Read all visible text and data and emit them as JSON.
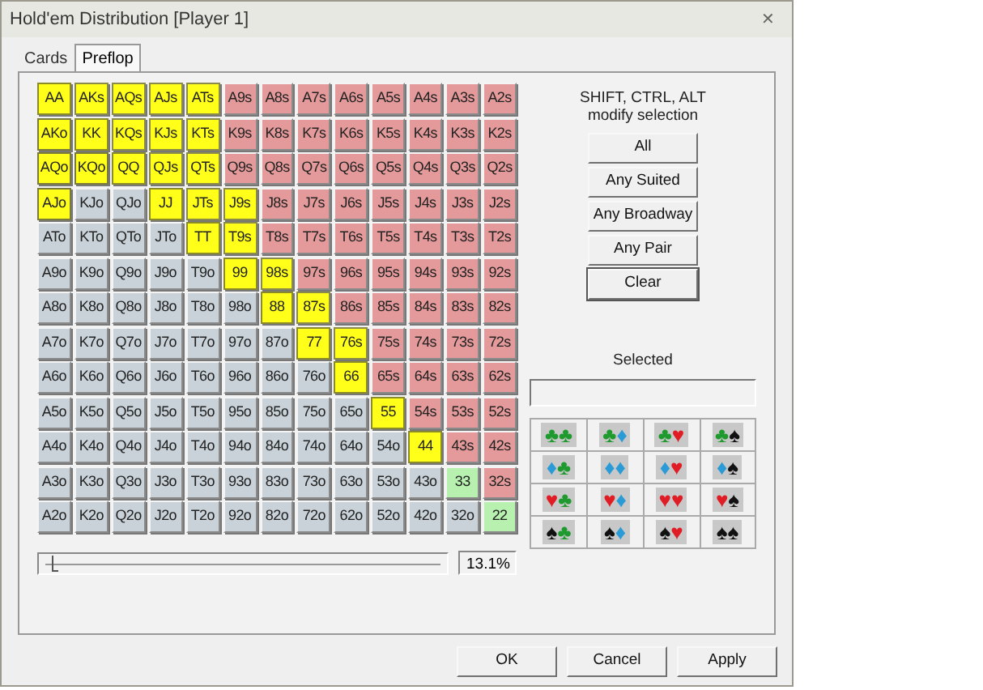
{
  "window": {
    "title": "Hold'em Distribution [Player 1]",
    "close": "✕"
  },
  "tabs": [
    {
      "label": "Cards",
      "selected": false
    },
    {
      "label": "Preflop",
      "selected": true
    }
  ],
  "grid": [
    [
      {
        "label": "AA",
        "kind": "pair",
        "selected": true
      },
      {
        "label": "AKs",
        "kind": "suited",
        "selected": true
      },
      {
        "label": "AQs",
        "kind": "suited",
        "selected": true
      },
      {
        "label": "AJs",
        "kind": "suited",
        "selected": true
      },
      {
        "label": "ATs",
        "kind": "suited",
        "selected": true
      },
      {
        "label": "A9s",
        "kind": "suited",
        "selected": false
      },
      {
        "label": "A8s",
        "kind": "suited",
        "selected": false
      },
      {
        "label": "A7s",
        "kind": "suited",
        "selected": false
      },
      {
        "label": "A6s",
        "kind": "suited",
        "selected": false
      },
      {
        "label": "A5s",
        "kind": "suited",
        "selected": false
      },
      {
        "label": "A4s",
        "kind": "suited",
        "selected": false
      },
      {
        "label": "A3s",
        "kind": "suited",
        "selected": false
      },
      {
        "label": "A2s",
        "kind": "suited",
        "selected": false
      }
    ],
    [
      {
        "label": "AKo",
        "kind": "offsuit",
        "selected": true
      },
      {
        "label": "KK",
        "kind": "pair",
        "selected": true
      },
      {
        "label": "KQs",
        "kind": "suited",
        "selected": true
      },
      {
        "label": "KJs",
        "kind": "suited",
        "selected": true
      },
      {
        "label": "KTs",
        "kind": "suited",
        "selected": true
      },
      {
        "label": "K9s",
        "kind": "suited",
        "selected": false
      },
      {
        "label": "K8s",
        "kind": "suited",
        "selected": false
      },
      {
        "label": "K7s",
        "kind": "suited",
        "selected": false
      },
      {
        "label": "K6s",
        "kind": "suited",
        "selected": false
      },
      {
        "label": "K5s",
        "kind": "suited",
        "selected": false
      },
      {
        "label": "K4s",
        "kind": "suited",
        "selected": false
      },
      {
        "label": "K3s",
        "kind": "suited",
        "selected": false
      },
      {
        "label": "K2s",
        "kind": "suited",
        "selected": false
      }
    ],
    [
      {
        "label": "AQo",
        "kind": "offsuit",
        "selected": true
      },
      {
        "label": "KQo",
        "kind": "offsuit",
        "selected": true
      },
      {
        "label": "QQ",
        "kind": "pair",
        "selected": true
      },
      {
        "label": "QJs",
        "kind": "suited",
        "selected": true
      },
      {
        "label": "QTs",
        "kind": "suited",
        "selected": true
      },
      {
        "label": "Q9s",
        "kind": "suited",
        "selected": false
      },
      {
        "label": "Q8s",
        "kind": "suited",
        "selected": false
      },
      {
        "label": "Q7s",
        "kind": "suited",
        "selected": false
      },
      {
        "label": "Q6s",
        "kind": "suited",
        "selected": false
      },
      {
        "label": "Q5s",
        "kind": "suited",
        "selected": false
      },
      {
        "label": "Q4s",
        "kind": "suited",
        "selected": false
      },
      {
        "label": "Q3s",
        "kind": "suited",
        "selected": false
      },
      {
        "label": "Q2s",
        "kind": "suited",
        "selected": false
      }
    ],
    [
      {
        "label": "AJo",
        "kind": "offsuit",
        "selected": true
      },
      {
        "label": "KJo",
        "kind": "offsuit",
        "selected": false
      },
      {
        "label": "QJo",
        "kind": "offsuit",
        "selected": false
      },
      {
        "label": "JJ",
        "kind": "pair",
        "selected": true
      },
      {
        "label": "JTs",
        "kind": "suited",
        "selected": true
      },
      {
        "label": "J9s",
        "kind": "suited",
        "selected": true
      },
      {
        "label": "J8s",
        "kind": "suited",
        "selected": false
      },
      {
        "label": "J7s",
        "kind": "suited",
        "selected": false
      },
      {
        "label": "J6s",
        "kind": "suited",
        "selected": false
      },
      {
        "label": "J5s",
        "kind": "suited",
        "selected": false
      },
      {
        "label": "J4s",
        "kind": "suited",
        "selected": false
      },
      {
        "label": "J3s",
        "kind": "suited",
        "selected": false
      },
      {
        "label": "J2s",
        "kind": "suited",
        "selected": false
      }
    ],
    [
      {
        "label": "ATo",
        "kind": "offsuit",
        "selected": false
      },
      {
        "label": "KTo",
        "kind": "offsuit",
        "selected": false
      },
      {
        "label": "QTo",
        "kind": "offsuit",
        "selected": false
      },
      {
        "label": "JTo",
        "kind": "offsuit",
        "selected": false
      },
      {
        "label": "TT",
        "kind": "pair",
        "selected": true
      },
      {
        "label": "T9s",
        "kind": "suited",
        "selected": true
      },
      {
        "label": "T8s",
        "kind": "suited",
        "selected": false
      },
      {
        "label": "T7s",
        "kind": "suited",
        "selected": false
      },
      {
        "label": "T6s",
        "kind": "suited",
        "selected": false
      },
      {
        "label": "T5s",
        "kind": "suited",
        "selected": false
      },
      {
        "label": "T4s",
        "kind": "suited",
        "selected": false
      },
      {
        "label": "T3s",
        "kind": "suited",
        "selected": false
      },
      {
        "label": "T2s",
        "kind": "suited",
        "selected": false
      }
    ],
    [
      {
        "label": "A9o",
        "kind": "offsuit",
        "selected": false
      },
      {
        "label": "K9o",
        "kind": "offsuit",
        "selected": false
      },
      {
        "label": "Q9o",
        "kind": "offsuit",
        "selected": false
      },
      {
        "label": "J9o",
        "kind": "offsuit",
        "selected": false
      },
      {
        "label": "T9o",
        "kind": "offsuit",
        "selected": false
      },
      {
        "label": "99",
        "kind": "pair",
        "selected": true
      },
      {
        "label": "98s",
        "kind": "suited",
        "selected": true
      },
      {
        "label": "97s",
        "kind": "suited",
        "selected": false
      },
      {
        "label": "96s",
        "kind": "suited",
        "selected": false
      },
      {
        "label": "95s",
        "kind": "suited",
        "selected": false
      },
      {
        "label": "94s",
        "kind": "suited",
        "selected": false
      },
      {
        "label": "93s",
        "kind": "suited",
        "selected": false
      },
      {
        "label": "92s",
        "kind": "suited",
        "selected": false
      }
    ],
    [
      {
        "label": "A8o",
        "kind": "offsuit",
        "selected": false
      },
      {
        "label": "K8o",
        "kind": "offsuit",
        "selected": false
      },
      {
        "label": "Q8o",
        "kind": "offsuit",
        "selected": false
      },
      {
        "label": "J8o",
        "kind": "offsuit",
        "selected": false
      },
      {
        "label": "T8o",
        "kind": "offsuit",
        "selected": false
      },
      {
        "label": "98o",
        "kind": "offsuit",
        "selected": false
      },
      {
        "label": "88",
        "kind": "pair",
        "selected": true
      },
      {
        "label": "87s",
        "kind": "suited",
        "selected": true
      },
      {
        "label": "86s",
        "kind": "suited",
        "selected": false
      },
      {
        "label": "85s",
        "kind": "suited",
        "selected": false
      },
      {
        "label": "84s",
        "kind": "suited",
        "selected": false
      },
      {
        "label": "83s",
        "kind": "suited",
        "selected": false
      },
      {
        "label": "82s",
        "kind": "suited",
        "selected": false
      }
    ],
    [
      {
        "label": "A7o",
        "kind": "offsuit",
        "selected": false
      },
      {
        "label": "K7o",
        "kind": "offsuit",
        "selected": false
      },
      {
        "label": "Q7o",
        "kind": "offsuit",
        "selected": false
      },
      {
        "label": "J7o",
        "kind": "offsuit",
        "selected": false
      },
      {
        "label": "T7o",
        "kind": "offsuit",
        "selected": false
      },
      {
        "label": "97o",
        "kind": "offsuit",
        "selected": false
      },
      {
        "label": "87o",
        "kind": "offsuit",
        "selected": false
      },
      {
        "label": "77",
        "kind": "pair",
        "selected": true
      },
      {
        "label": "76s",
        "kind": "suited",
        "selected": true
      },
      {
        "label": "75s",
        "kind": "suited",
        "selected": false
      },
      {
        "label": "74s",
        "kind": "suited",
        "selected": false
      },
      {
        "label": "73s",
        "kind": "suited",
        "selected": false
      },
      {
        "label": "72s",
        "kind": "suited",
        "selected": false
      }
    ],
    [
      {
        "label": "A6o",
        "kind": "offsuit",
        "selected": false
      },
      {
        "label": "K6o",
        "kind": "offsuit",
        "selected": false
      },
      {
        "label": "Q6o",
        "kind": "offsuit",
        "selected": false
      },
      {
        "label": "J6o",
        "kind": "offsuit",
        "selected": false
      },
      {
        "label": "T6o",
        "kind": "offsuit",
        "selected": false
      },
      {
        "label": "96o",
        "kind": "offsuit",
        "selected": false
      },
      {
        "label": "86o",
        "kind": "offsuit",
        "selected": false
      },
      {
        "label": "76o",
        "kind": "offsuit",
        "selected": false
      },
      {
        "label": "66",
        "kind": "pair",
        "selected": true
      },
      {
        "label": "65s",
        "kind": "suited",
        "selected": false
      },
      {
        "label": "64s",
        "kind": "suited",
        "selected": false
      },
      {
        "label": "63s",
        "kind": "suited",
        "selected": false
      },
      {
        "label": "62s",
        "kind": "suited",
        "selected": false
      }
    ],
    [
      {
        "label": "A5o",
        "kind": "offsuit",
        "selected": false
      },
      {
        "label": "K5o",
        "kind": "offsuit",
        "selected": false
      },
      {
        "label": "Q5o",
        "kind": "offsuit",
        "selected": false
      },
      {
        "label": "J5o",
        "kind": "offsuit",
        "selected": false
      },
      {
        "label": "T5o",
        "kind": "offsuit",
        "selected": false
      },
      {
        "label": "95o",
        "kind": "offsuit",
        "selected": false
      },
      {
        "label": "85o",
        "kind": "offsuit",
        "selected": false
      },
      {
        "label": "75o",
        "kind": "offsuit",
        "selected": false
      },
      {
        "label": "65o",
        "kind": "offsuit",
        "selected": false
      },
      {
        "label": "55",
        "kind": "pair",
        "selected": true
      },
      {
        "label": "54s",
        "kind": "suited",
        "selected": false
      },
      {
        "label": "53s",
        "kind": "suited",
        "selected": false
      },
      {
        "label": "52s",
        "kind": "suited",
        "selected": false
      }
    ],
    [
      {
        "label": "A4o",
        "kind": "offsuit",
        "selected": false
      },
      {
        "label": "K4o",
        "kind": "offsuit",
        "selected": false
      },
      {
        "label": "Q4o",
        "kind": "offsuit",
        "selected": false
      },
      {
        "label": "J4o",
        "kind": "offsuit",
        "selected": false
      },
      {
        "label": "T4o",
        "kind": "offsuit",
        "selected": false
      },
      {
        "label": "94o",
        "kind": "offsuit",
        "selected": false
      },
      {
        "label": "84o",
        "kind": "offsuit",
        "selected": false
      },
      {
        "label": "74o",
        "kind": "offsuit",
        "selected": false
      },
      {
        "label": "64o",
        "kind": "offsuit",
        "selected": false
      },
      {
        "label": "54o",
        "kind": "offsuit",
        "selected": false
      },
      {
        "label": "44",
        "kind": "pair",
        "selected": true
      },
      {
        "label": "43s",
        "kind": "suited",
        "selected": false
      },
      {
        "label": "42s",
        "kind": "suited",
        "selected": false
      }
    ],
    [
      {
        "label": "A3o",
        "kind": "offsuit",
        "selected": false
      },
      {
        "label": "K3o",
        "kind": "offsuit",
        "selected": false
      },
      {
        "label": "Q3o",
        "kind": "offsuit",
        "selected": false
      },
      {
        "label": "J3o",
        "kind": "offsuit",
        "selected": false
      },
      {
        "label": "T3o",
        "kind": "offsuit",
        "selected": false
      },
      {
        "label": "93o",
        "kind": "offsuit",
        "selected": false
      },
      {
        "label": "83o",
        "kind": "offsuit",
        "selected": false
      },
      {
        "label": "73o",
        "kind": "offsuit",
        "selected": false
      },
      {
        "label": "63o",
        "kind": "offsuit",
        "selected": false
      },
      {
        "label": "53o",
        "kind": "offsuit",
        "selected": false
      },
      {
        "label": "43o",
        "kind": "offsuit",
        "selected": false
      },
      {
        "label": "33",
        "kind": "pair",
        "selected": false
      },
      {
        "label": "32s",
        "kind": "suited",
        "selected": false
      }
    ],
    [
      {
        "label": "A2o",
        "kind": "offsuit",
        "selected": false
      },
      {
        "label": "K2o",
        "kind": "offsuit",
        "selected": false
      },
      {
        "label": "Q2o",
        "kind": "offsuit",
        "selected": false
      },
      {
        "label": "J2o",
        "kind": "offsuit",
        "selected": false
      },
      {
        "label": "T2o",
        "kind": "offsuit",
        "selected": false
      },
      {
        "label": "92o",
        "kind": "offsuit",
        "selected": false
      },
      {
        "label": "82o",
        "kind": "offsuit",
        "selected": false
      },
      {
        "label": "72o",
        "kind": "offsuit",
        "selected": false
      },
      {
        "label": "62o",
        "kind": "offsuit",
        "selected": false
      },
      {
        "label": "52o",
        "kind": "offsuit",
        "selected": false
      },
      {
        "label": "42o",
        "kind": "offsuit",
        "selected": false
      },
      {
        "label": "32o",
        "kind": "offsuit",
        "selected": false
      },
      {
        "label": "22",
        "kind": "pair",
        "selected": false
      }
    ]
  ],
  "slider": {
    "level": 0.02,
    "reading": "13.1%"
  },
  "hint": "SHIFT, CTRL, ALT modify selection",
  "buttons": [
    {
      "label": "All",
      "kind": "normal"
    },
    {
      "label": "Any Suited",
      "kind": "normal"
    },
    {
      "label": "Any Broadway",
      "kind": "normal"
    },
    {
      "label": "Any Pair",
      "kind": "normal"
    },
    {
      "label": "Clear",
      "kind": "default"
    }
  ],
  "selected_label": "Selected",
  "suits": [
    {
      "symbol": "♣",
      "color": "#1f9a2e"
    },
    {
      "symbol": "♦",
      "color": "#2a9bd6"
    },
    {
      "symbol": "♥",
      "color": "#e01c24"
    },
    {
      "symbol": "♠",
      "color": "#111111"
    }
  ],
  "footer_buttons": [
    "OK",
    "Cancel",
    "Apply"
  ]
}
